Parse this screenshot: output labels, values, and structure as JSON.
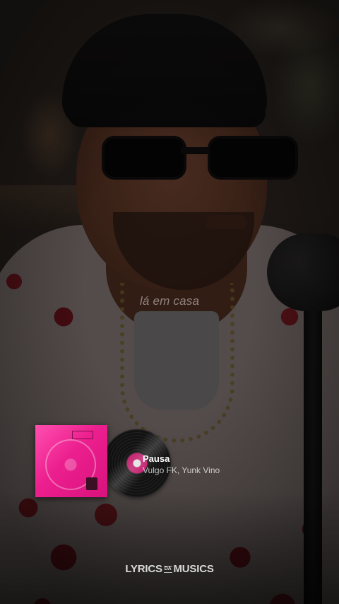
{
  "lyric": "lá em casa",
  "now_playing": {
    "title": "Pausa",
    "artist": "Vulgo FK, Yunk Vino"
  },
  "brand": {
    "left": "LYRICS",
    "middle": "DA",
    "right": "MUSICS"
  },
  "colors": {
    "cover_pink": "#ec1f8e",
    "vinyl_label": "#c01a6a"
  }
}
